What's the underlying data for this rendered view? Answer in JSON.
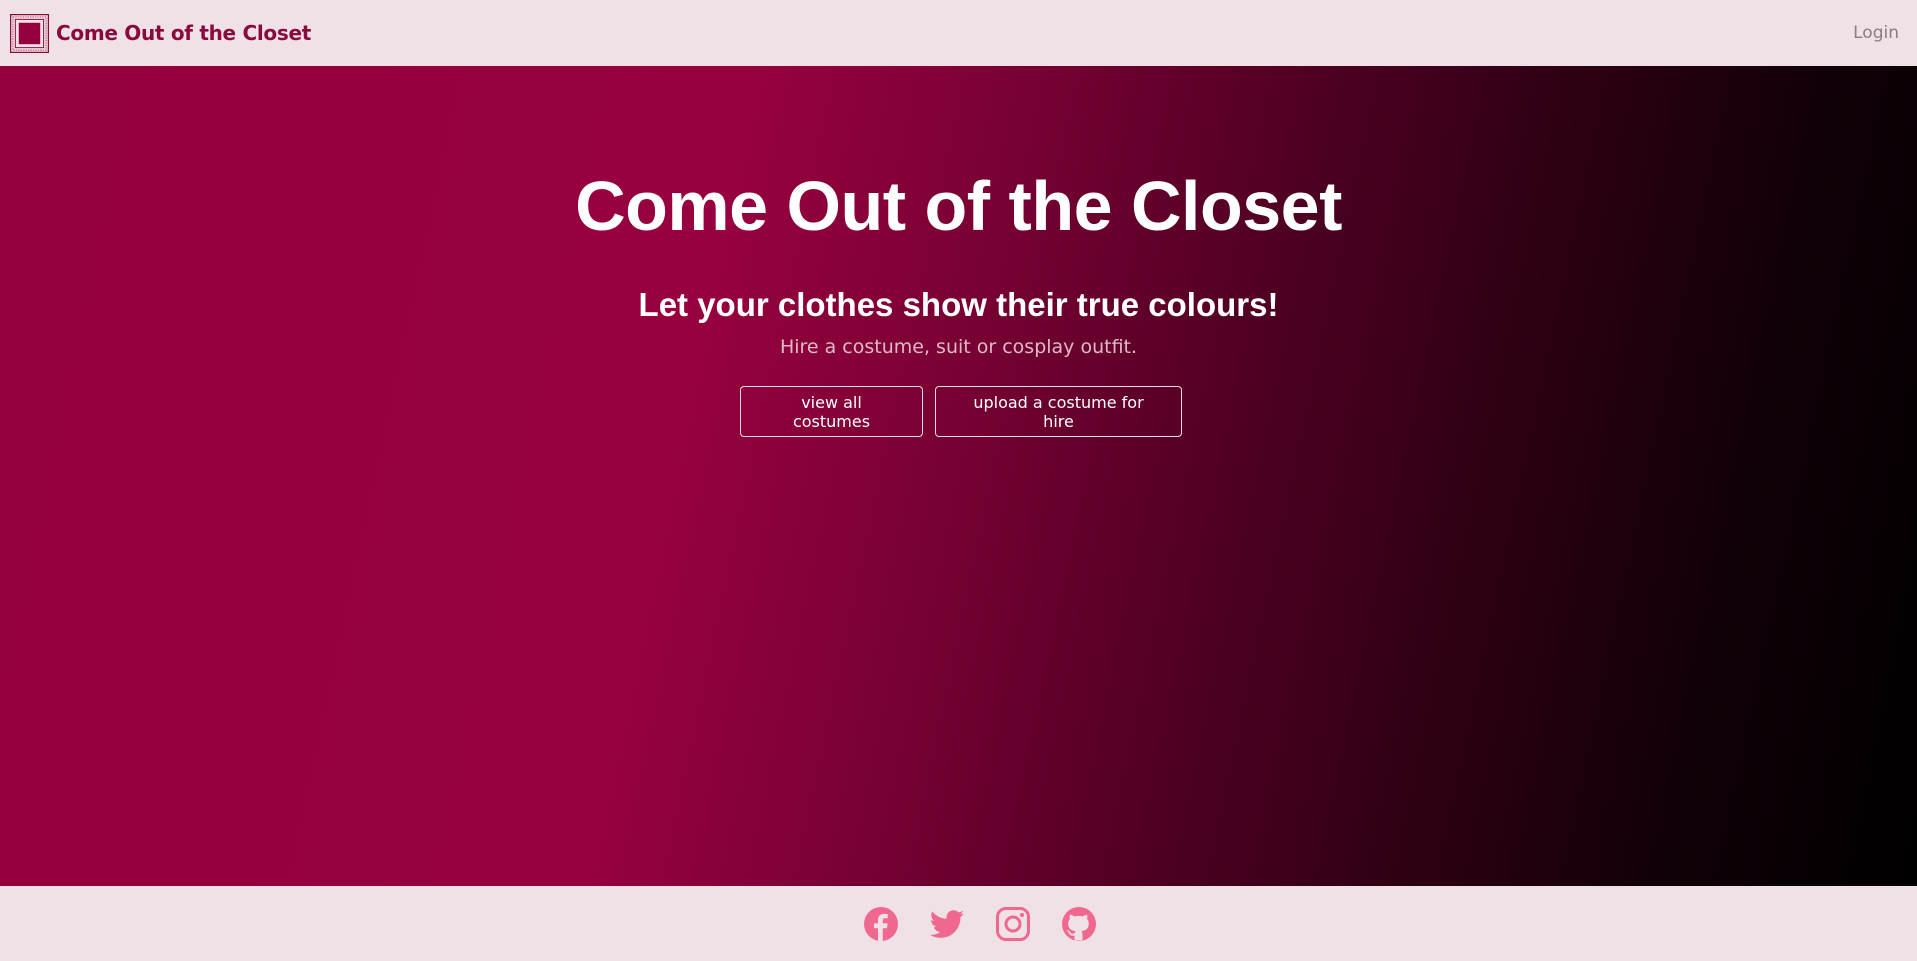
{
  "nav": {
    "brand": "Come Out of the Closet",
    "login": "Login"
  },
  "hero": {
    "title": "Come Out of the Closet",
    "subtitle": "Let your clothes show their true colours!",
    "tagline": "Hire a costume, suit or cosplay outfit.",
    "buttons": {
      "view_all": "view all costumes",
      "upload": "upload a costume for hire"
    }
  },
  "footer": {
    "social": [
      "facebook-icon",
      "twitter-icon",
      "instagram-icon",
      "github-icon"
    ]
  },
  "colors": {
    "brand": "#8a0a3e",
    "hero_start": "#95003e",
    "hero_end": "#000000",
    "social_icon": "#f0688f",
    "chrome_bg": "#efe1e6"
  }
}
